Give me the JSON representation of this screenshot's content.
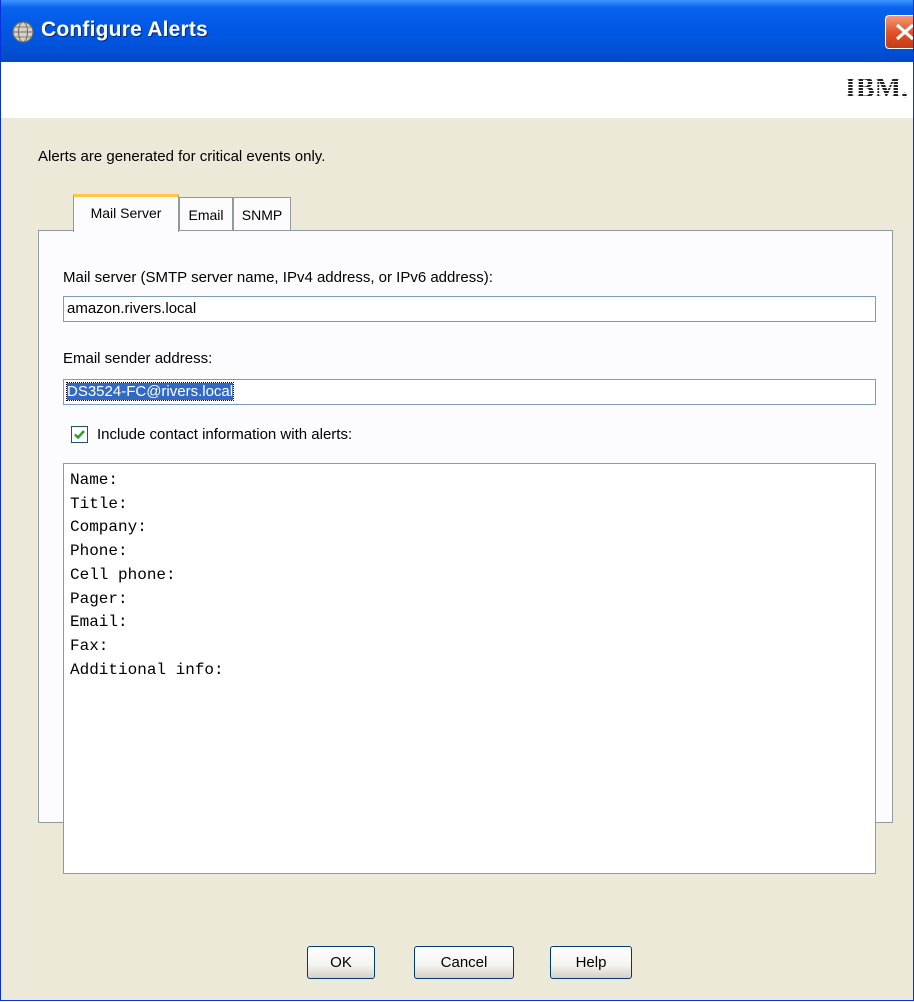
{
  "window": {
    "title": "Configure Alerts",
    "logo_text": "IBM.",
    "colors": {
      "titlebar": "#0058e4",
      "tab_highlight": "#ffc83c",
      "selection": "#316ac5",
      "close_button": "#e0532c"
    }
  },
  "info_text": "Alerts are generated for critical events only.",
  "tabs": [
    {
      "label": "Mail Server",
      "active": true
    },
    {
      "label": "Email",
      "active": false
    },
    {
      "label": "SNMP",
      "active": false
    }
  ],
  "mail_server": {
    "label": "Mail server (SMTP server name, IPv4 address, or IPv6 address):",
    "value": "amazon.rivers.local"
  },
  "sender": {
    "label": "Email sender address:",
    "value": "DS3524-FC@rivers.local"
  },
  "contact": {
    "checkbox_label": "Include contact information with alerts:",
    "checked": true,
    "text": "Name:\nTitle:\nCompany:\nPhone:\nCell phone:\nPager:\nEmail:\nFax:\nAdditional info:"
  },
  "buttons": {
    "ok": "OK",
    "cancel": "Cancel",
    "help": "Help"
  },
  "icons": {
    "window": "globe-icon",
    "close": "close-icon",
    "check": "checkmark-icon"
  }
}
